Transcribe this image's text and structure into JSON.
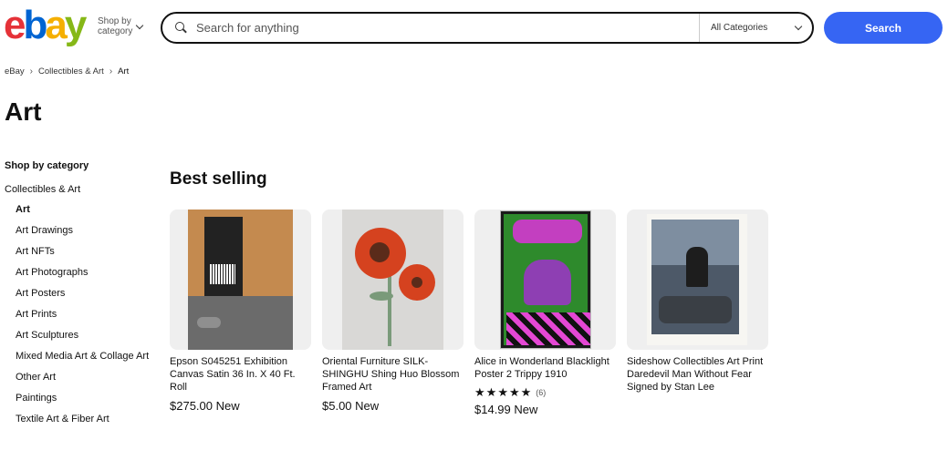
{
  "header": {
    "logo_letters": [
      "e",
      "b",
      "a",
      "y"
    ],
    "shop_by_line1": "Shop by",
    "shop_by_line2": "category",
    "search_placeholder": "Search for anything",
    "category_select": "All Categories",
    "search_button": "Search"
  },
  "breadcrumb": {
    "items": [
      "eBay",
      "Collectibles & Art",
      "Art"
    ]
  },
  "page_title": "Art",
  "sidebar": {
    "heading": "Shop by category",
    "parent": "Collectibles & Art",
    "items": [
      "Art",
      "Art Drawings",
      "Art NFTs",
      "Art Photographs",
      "Art Posters",
      "Art Prints",
      "Art Sculptures",
      "Mixed Media Art & Collage Art",
      "Other Art",
      "Paintings",
      "Textile Art & Fiber Art"
    ],
    "active_index": 0
  },
  "best_selling": {
    "title": "Best selling",
    "items": [
      {
        "title": "Epson S045251 Exhibition Canvas Satin 36 In. X 40 Ft. Roll",
        "price": "$275.00 New"
      },
      {
        "title": "Oriental Furniture SILK-SHINGHU Shing Huo Blossom Framed Art",
        "price": "$5.00 New"
      },
      {
        "title": "Alice in Wonderland Blacklight Poster 2 Trippy 1910",
        "rating_stars": 5,
        "rating_count": "(6)",
        "price": "$14.99 New"
      },
      {
        "title": "Sideshow Collectibles Art Print Daredevil Man Without Fear Signed by Stan Lee",
        "price": ""
      }
    ]
  },
  "colors": {
    "ebay_red": "#e53238",
    "ebay_blue": "#0064d2",
    "ebay_yellow": "#f5af02",
    "ebay_green": "#86b817",
    "search_button": "#3665f3"
  }
}
